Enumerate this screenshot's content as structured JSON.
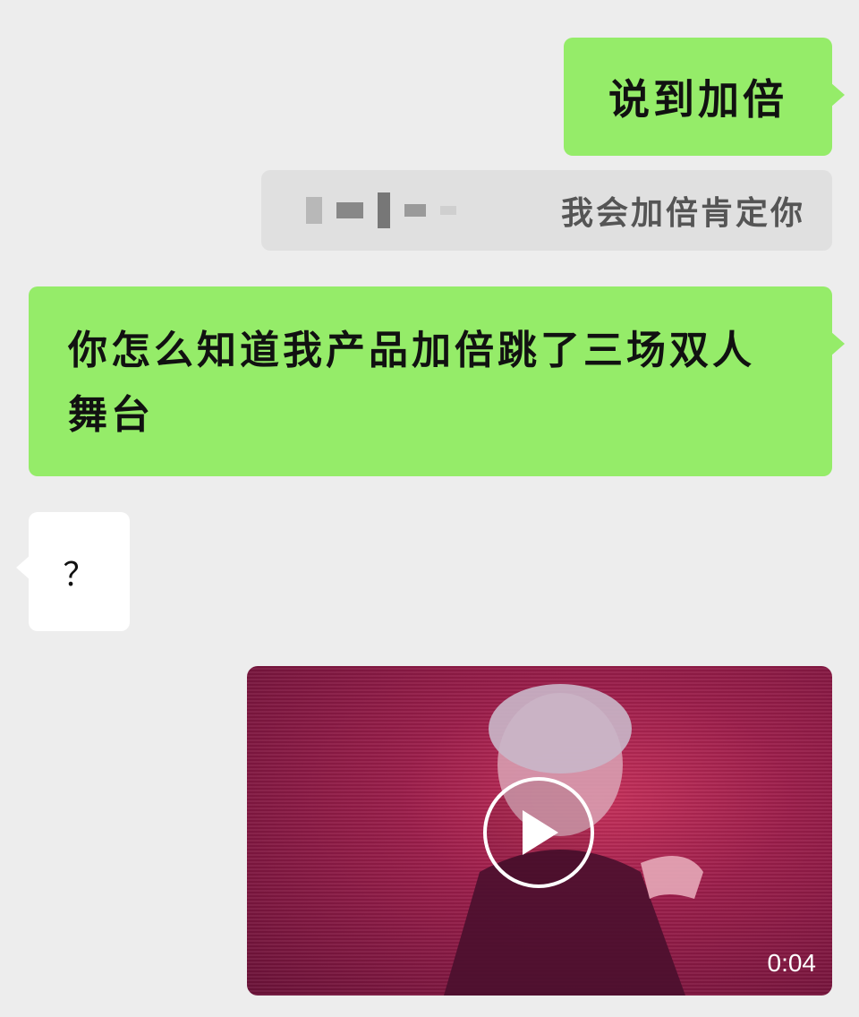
{
  "messages": [
    {
      "id": "msg1",
      "side": "right",
      "text": "说到加倍"
    },
    {
      "id": "quote",
      "type": "quoted-reply",
      "text": "我会加倍肯定你"
    },
    {
      "id": "msg2",
      "side": "right",
      "text": "你怎么知道我产品加倍跳了三场双人舞台"
    },
    {
      "id": "msg3",
      "side": "left",
      "text": "？"
    },
    {
      "id": "video",
      "side": "right",
      "type": "video",
      "duration": "0:04"
    }
  ],
  "icons": {
    "play": "play-circle-icon"
  },
  "colors": {
    "background": "#ededed",
    "sent_bubble": "#95ec69",
    "received_bubble": "#ffffff",
    "quote_bg": "#e0e0e0",
    "video_tint": "#b0285a"
  }
}
